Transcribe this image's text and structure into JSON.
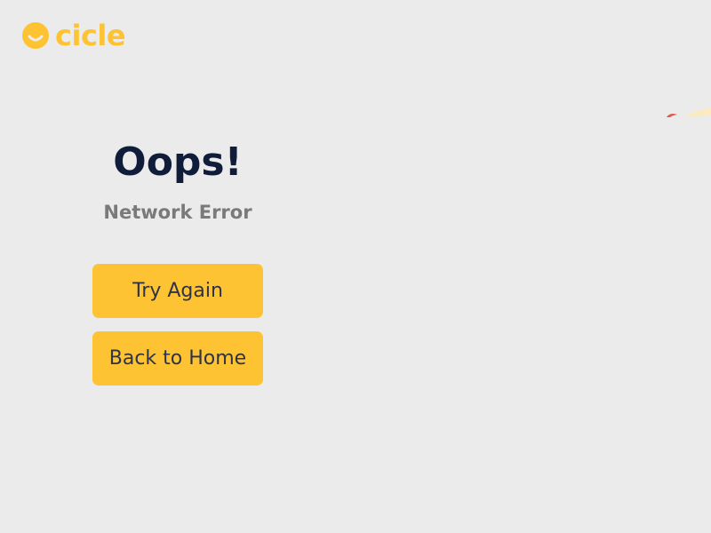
{
  "colors": {
    "background": "#ebebeb",
    "brand": "#fdc333",
    "title": "#0f1d3a",
    "subtitle": "#7a7a7a",
    "button_bg": "#fdc333",
    "button_text": "#2e3446",
    "deco_red": "#e4584a",
    "deco_cream": "#fbeac0"
  },
  "logo": {
    "icon": "smile-circle-icon",
    "text": "cicle"
  },
  "decoration": {
    "icon": "corner-illustration-icon"
  },
  "error": {
    "title": "Oops!",
    "subtitle": "Network Error"
  },
  "actions": {
    "try_again_label": "Try Again",
    "back_home_label": "Back to Home"
  }
}
